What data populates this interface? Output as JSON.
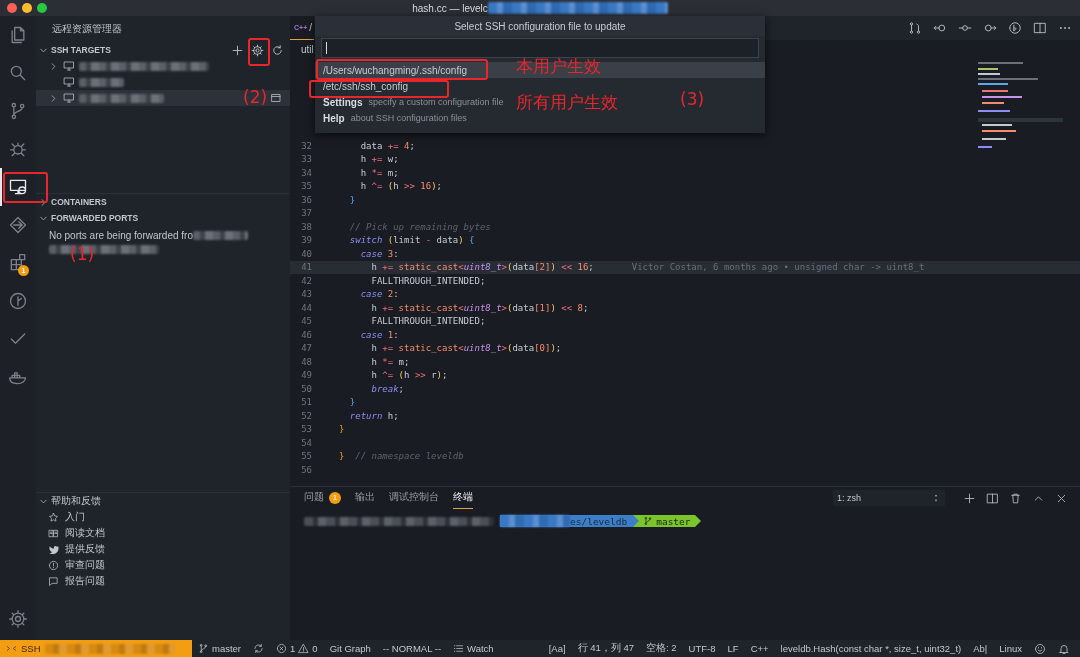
{
  "window": {
    "title": "hash.cc — levelc"
  },
  "activity_bar": [
    {
      "kind": "files",
      "selected": false
    },
    {
      "kind": "search",
      "selected": false
    },
    {
      "kind": "scm",
      "selected": false
    },
    {
      "kind": "debug",
      "selected": false
    },
    {
      "kind": "remote",
      "selected": true
    },
    {
      "kind": "share",
      "selected": false
    },
    {
      "kind": "extensions",
      "selected": false,
      "badge": "1"
    },
    {
      "kind": "history",
      "selected": false
    },
    {
      "kind": "check",
      "selected": false
    },
    {
      "kind": "docker",
      "selected": false
    }
  ],
  "sidebar": {
    "title": "远程资源管理器",
    "ssh_targets": {
      "title": "SSH TARGETS",
      "expanded": true,
      "rows": [
        {
          "expandable": true,
          "selected": false
        },
        {
          "expandable": false,
          "selected": false
        },
        {
          "expandable": true,
          "selected": true
        }
      ]
    },
    "containers": {
      "title": "CONTAINERS",
      "expanded": false
    },
    "forwarded_ports": {
      "title": "FORWARDED PORTS",
      "expanded": true,
      "message": "No ports are being forwarded fro"
    },
    "help": {
      "title": "帮助和反馈",
      "expanded": true,
      "items": [
        {
          "label": "入门",
          "kind": "star"
        },
        {
          "label": "阅读文档",
          "kind": "book"
        },
        {
          "label": "提供反馈",
          "kind": "bird"
        },
        {
          "label": "审查问题",
          "kind": "alert"
        },
        {
          "label": "报告问题",
          "kind": "chat"
        }
      ]
    }
  },
  "editor": {
    "tab": {
      "icon_text": "C++",
      "label": "/",
      "selected": true
    },
    "breadcrumb": "util",
    "lines": [
      {
        "number": "32",
        "tokens": [
          {
            "kind": "p",
            "text": "    data "
          },
          {
            "kind": "op",
            "text": "+="
          },
          {
            "kind": "n",
            "text": " 4"
          },
          {
            "kind": "p",
            "text": ";"
          }
        ]
      },
      {
        "number": "33",
        "tokens": [
          {
            "kind": "p",
            "text": "    h "
          },
          {
            "kind": "op",
            "text": "+="
          },
          {
            "kind": "p",
            "text": " w;"
          }
        ]
      },
      {
        "number": "34",
        "tokens": [
          {
            "kind": "p",
            "text": "    h "
          },
          {
            "kind": "op",
            "text": "*="
          },
          {
            "kind": "p",
            "text": " m;"
          }
        ]
      },
      {
        "number": "35",
        "tokens": [
          {
            "kind": "p",
            "text": "    h "
          },
          {
            "kind": "op",
            "text": "^="
          },
          {
            "kind": "br",
            "text": " ("
          },
          {
            "kind": "p",
            "text": "h "
          },
          {
            "kind": "op",
            "text": ">>"
          },
          {
            "kind": "n",
            "text": " 16"
          },
          {
            "kind": "br",
            "text": ")"
          },
          {
            "kind": "p",
            "text": ";"
          }
        ]
      },
      {
        "number": "36",
        "tokens": [
          {
            "kind": "bb",
            "text": "  }"
          }
        ]
      },
      {
        "number": "37"
      },
      {
        "number": "38",
        "tokens": [
          {
            "kind": "c",
            "text": "  // Pick up remaining bytes"
          }
        ]
      },
      {
        "number": "39",
        "tokens": [
          {
            "kind": "kw",
            "text": "  switch"
          },
          {
            "kind": "br",
            "text": " ("
          },
          {
            "kind": "p",
            "text": "limit "
          },
          {
            "kind": "op",
            "text": "-"
          },
          {
            "kind": "p",
            "text": " data"
          },
          {
            "kind": "br",
            "text": ")"
          },
          {
            "kind": "bb",
            "text": " {"
          }
        ]
      },
      {
        "number": "40",
        "tokens": [
          {
            "kind": "kw",
            "text": "    case"
          },
          {
            "kind": "n",
            "text": " 3"
          },
          {
            "kind": "p",
            "text": ":"
          }
        ]
      },
      {
        "number": "41",
        "current": true,
        "blame": "Victor Costan, 6 months ago • unsigned char -> uint8_t",
        "tokens": [
          {
            "kind": "p",
            "text": "      h "
          },
          {
            "kind": "op",
            "text": "+="
          },
          {
            "kind": "fn",
            "text": " static_cast"
          },
          {
            "kind": "op",
            "text": "<"
          },
          {
            "kind": "ty",
            "text": "uint8_t"
          },
          {
            "kind": "op",
            "text": ">"
          },
          {
            "kind": "br",
            "text": "("
          },
          {
            "kind": "p",
            "text": "data"
          },
          {
            "kind": "n",
            "text": "[2]"
          },
          {
            "kind": "br",
            "text": ")"
          },
          {
            "kind": "op",
            "text": " <<"
          },
          {
            "kind": "n",
            "text": " 16"
          },
          {
            "kind": "p",
            "text": ";"
          }
        ]
      },
      {
        "number": "42",
        "tokens": [
          {
            "kind": "p",
            "text": "      FALLTHROUGH_INTENDED;"
          }
        ]
      },
      {
        "number": "43",
        "tokens": [
          {
            "kind": "kw",
            "text": "    case"
          },
          {
            "kind": "n",
            "text": " 2"
          },
          {
            "kind": "p",
            "text": ":"
          }
        ]
      },
      {
        "number": "44",
        "tokens": [
          {
            "kind": "p",
            "text": "      h "
          },
          {
            "kind": "op",
            "text": "+="
          },
          {
            "kind": "fn",
            "text": " static_cast"
          },
          {
            "kind": "op",
            "text": "<"
          },
          {
            "kind": "ty",
            "text": "uint8_t"
          },
          {
            "kind": "op",
            "text": ">"
          },
          {
            "kind": "br",
            "text": "("
          },
          {
            "kind": "p",
            "text": "data"
          },
          {
            "kind": "n",
            "text": "[1]"
          },
          {
            "kind": "br",
            "text": ")"
          },
          {
            "kind": "op",
            "text": " <<"
          },
          {
            "kind": "n",
            "text": " 8"
          },
          {
            "kind": "p",
            "text": ";"
          }
        ]
      },
      {
        "number": "45",
        "tokens": [
          {
            "kind": "p",
            "text": "      FALLTHROUGH_INTENDED;"
          }
        ]
      },
      {
        "number": "46",
        "tokens": [
          {
            "kind": "kw",
            "text": "    case"
          },
          {
            "kind": "n",
            "text": " 1"
          },
          {
            "kind": "p",
            "text": ":"
          }
        ]
      },
      {
        "number": "47",
        "tokens": [
          {
            "kind": "p",
            "text": "      h "
          },
          {
            "kind": "op",
            "text": "+="
          },
          {
            "kind": "fn",
            "text": " static_cast"
          },
          {
            "kind": "op",
            "text": "<"
          },
          {
            "kind": "ty",
            "text": "uint8_t"
          },
          {
            "kind": "op",
            "text": ">"
          },
          {
            "kind": "br",
            "text": "("
          },
          {
            "kind": "p",
            "text": "data"
          },
          {
            "kind": "n",
            "text": "[0]"
          },
          {
            "kind": "br",
            "text": ")"
          },
          {
            "kind": "p",
            "text": ";"
          }
        ]
      },
      {
        "number": "48",
        "tokens": [
          {
            "kind": "p",
            "text": "      h "
          },
          {
            "kind": "op",
            "text": "*="
          },
          {
            "kind": "p",
            "text": " m;"
          }
        ]
      },
      {
        "number": "49",
        "tokens": [
          {
            "kind": "p",
            "text": "      h "
          },
          {
            "kind": "op",
            "text": "^="
          },
          {
            "kind": "br",
            "text": " ("
          },
          {
            "kind": "p",
            "text": "h "
          },
          {
            "kind": "op",
            "text": ">>"
          },
          {
            "kind": "p",
            "text": " r"
          },
          {
            "kind": "br",
            "text": ")"
          },
          {
            "kind": "p",
            "text": ";"
          }
        ]
      },
      {
        "number": "50",
        "tokens": [
          {
            "kind": "kw",
            "text": "      break"
          },
          {
            "kind": "p",
            "text": ";"
          }
        ]
      },
      {
        "number": "51",
        "tokens": [
          {
            "kind": "bb",
            "text": "  }"
          }
        ]
      },
      {
        "number": "52",
        "tokens": [
          {
            "kind": "kw",
            "text": "  return"
          },
          {
            "kind": "p",
            "text": " h;"
          }
        ]
      },
      {
        "number": "53",
        "tokens": [
          {
            "kind": "ob",
            "text": "}"
          }
        ]
      },
      {
        "number": "54"
      },
      {
        "number": "55",
        "tokens": [
          {
            "kind": "ob",
            "text": "}"
          },
          {
            "kind": "c",
            "text": "  // namespace leveldb"
          }
        ]
      },
      {
        "number": "56"
      }
    ]
  },
  "quick_pick": {
    "title": "Select SSH configuration file to update",
    "items": [
      {
        "label": "/Users/wuchangming/.ssh/config",
        "selected": true
      },
      {
        "label": "/etc/ssh/ssh_config",
        "selected": false
      },
      {
        "label": "Settings",
        "description": "specify a custom configuration file",
        "selected": false
      },
      {
        "label": "Help",
        "description": "about SSH configuration files",
        "selected": false
      }
    ]
  },
  "panel": {
    "tabs": [
      {
        "label": "问题",
        "badge": "1",
        "selected": false
      },
      {
        "label": "输出",
        "selected": false
      },
      {
        "label": "调试控制台",
        "selected": false
      },
      {
        "label": "终端",
        "selected": true
      }
    ],
    "terminal_select": "1: zsh",
    "prompt": {
      "path_tail": "es/leveldb",
      "branch": "master"
    }
  },
  "status_bar": {
    "left": [
      {
        "kind": "remote",
        "text": "SSH"
      },
      {
        "kind": "branch",
        "text": "master"
      },
      {
        "kind": "sync"
      },
      {
        "kind": "problems",
        "errors": "1",
        "warnings": "0"
      },
      {
        "kind": "text",
        "text": "Git Graph"
      },
      {
        "kind": "text",
        "text": "-- NORMAL --"
      },
      {
        "kind": "list",
        "text": "Watch"
      }
    ],
    "right": [
      {
        "kind": "text",
        "text": "[Aa]"
      },
      {
        "kind": "text",
        "text": "行 41，列 47"
      },
      {
        "kind": "text",
        "text": "空格: 2"
      },
      {
        "kind": "text",
        "text": "UTF-8"
      },
      {
        "kind": "text",
        "text": "LF"
      },
      {
        "kind": "text",
        "text": "C++"
      },
      {
        "kind": "text",
        "text": "leveldb.Hash(const char *, size_t, uint32_t)"
      },
      {
        "kind": "text",
        "text": "Ab|"
      },
      {
        "kind": "text",
        "text": "Linux"
      },
      {
        "kind": "smiley"
      },
      {
        "kind": "bell"
      }
    ]
  },
  "annotations": [
    "(1)",
    "(2)",
    "(3)",
    "本用户生效",
    "所有用户生效"
  ]
}
